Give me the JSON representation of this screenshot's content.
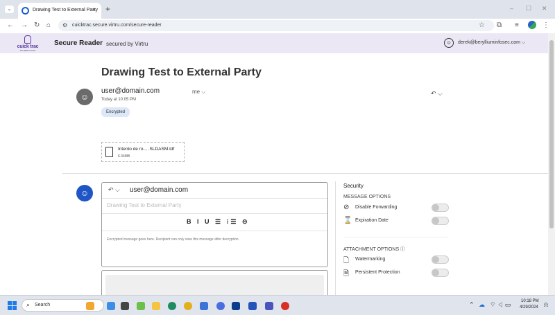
{
  "browser": {
    "tab_title": "Drawing Test to External Party",
    "new_tab": "+",
    "tab_close": "×",
    "url": "cuicktrac.secure.virtru.com/secure-reader",
    "minimize": "–",
    "maximize": "☐",
    "close": "✕"
  },
  "app": {
    "brand_name": "cuick trac",
    "brand_sub": "BY BERYLLIUM",
    "title": "Secure Reader",
    "subtitle": "secured by Virtru",
    "user_email": "derek@berylliuminfosec.com ⌵"
  },
  "message": {
    "subject": "Drawing Test to External Party",
    "from": "user@domain.com",
    "to": "me ⌵",
    "time": "Today at 10:05 PM",
    "badge": "Encrypted",
    "reply_icon": "↶ ⌵",
    "attachment": {
      "name": "Intento de ro... .SLDASM.tdf",
      "size": "6.34MB"
    }
  },
  "compose": {
    "reply_icon": "↶ ⌵",
    "to": "user@domain.com",
    "subject_placeholder": "Drawing Test to External Party",
    "format_buttons": "B I U ☰ ⁝☰ ⊝",
    "body": "Encrypted message goes here. Recipient can only view this message after decryption."
  },
  "security": {
    "title": "Security",
    "message_options": "MESSAGE OPTIONS",
    "disable_forwarding": "Disable Forwarding",
    "expiration_date": "Expiration Date",
    "attachment_options": "ATTACHMENT OPTIONS  ⓘ",
    "watermarking": "Watermarking",
    "persistent_protection": "Persistent Protection",
    "toggles": {
      "disable_forwarding": false,
      "expiration_date": false,
      "watermarking": false,
      "persistent_protection": false
    }
  },
  "taskbar": {
    "search": "Search",
    "time": "10:18 PM",
    "date": "4/29/2024"
  }
}
